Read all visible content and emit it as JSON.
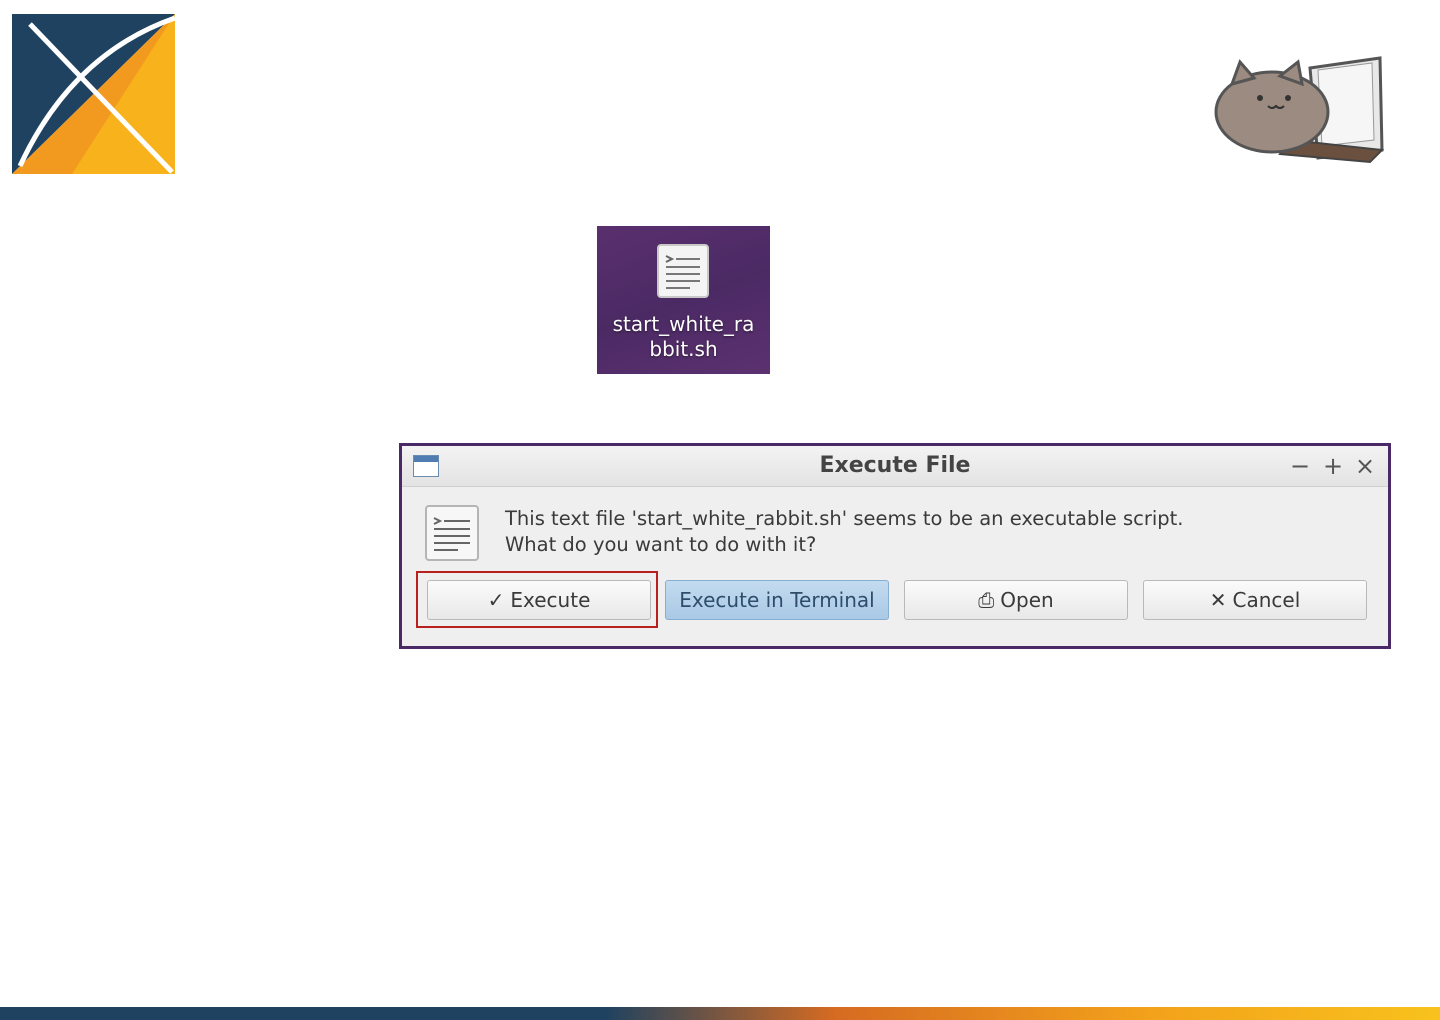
{
  "desktop": {
    "file_label": "start_white_rabbit.sh",
    "file_label_line1": "start_white_ra",
    "file_label_line2": "bbit.sh",
    "file_icon": "script-file-icon"
  },
  "dialog": {
    "title": "Execute File",
    "controls": {
      "minimize": "−",
      "maximize": "+",
      "close": "×"
    },
    "message_line1": "This text file 'start_white_rabbit.sh' seems to be an executable script.",
    "message_line2": "What do you want to do with it?",
    "buttons": [
      {
        "label": "Execute",
        "icon": "checkmark-icon",
        "glyph": "✓",
        "highlighted": true
      },
      {
        "label": "Execute in Terminal",
        "icon": "",
        "glyph": "",
        "focused": true
      },
      {
        "label": "Open",
        "icon": "open-icon",
        "glyph": "⎙"
      },
      {
        "label": "Cancel",
        "icon": "cancel-icon",
        "glyph": "✕"
      }
    ]
  },
  "colors": {
    "highlight": "#b7201c",
    "dialog_border": "#4a2a66",
    "focused_button": "#a9c9e6",
    "brand_navy": "#1e4260",
    "brand_orange": "#f3a21b"
  }
}
